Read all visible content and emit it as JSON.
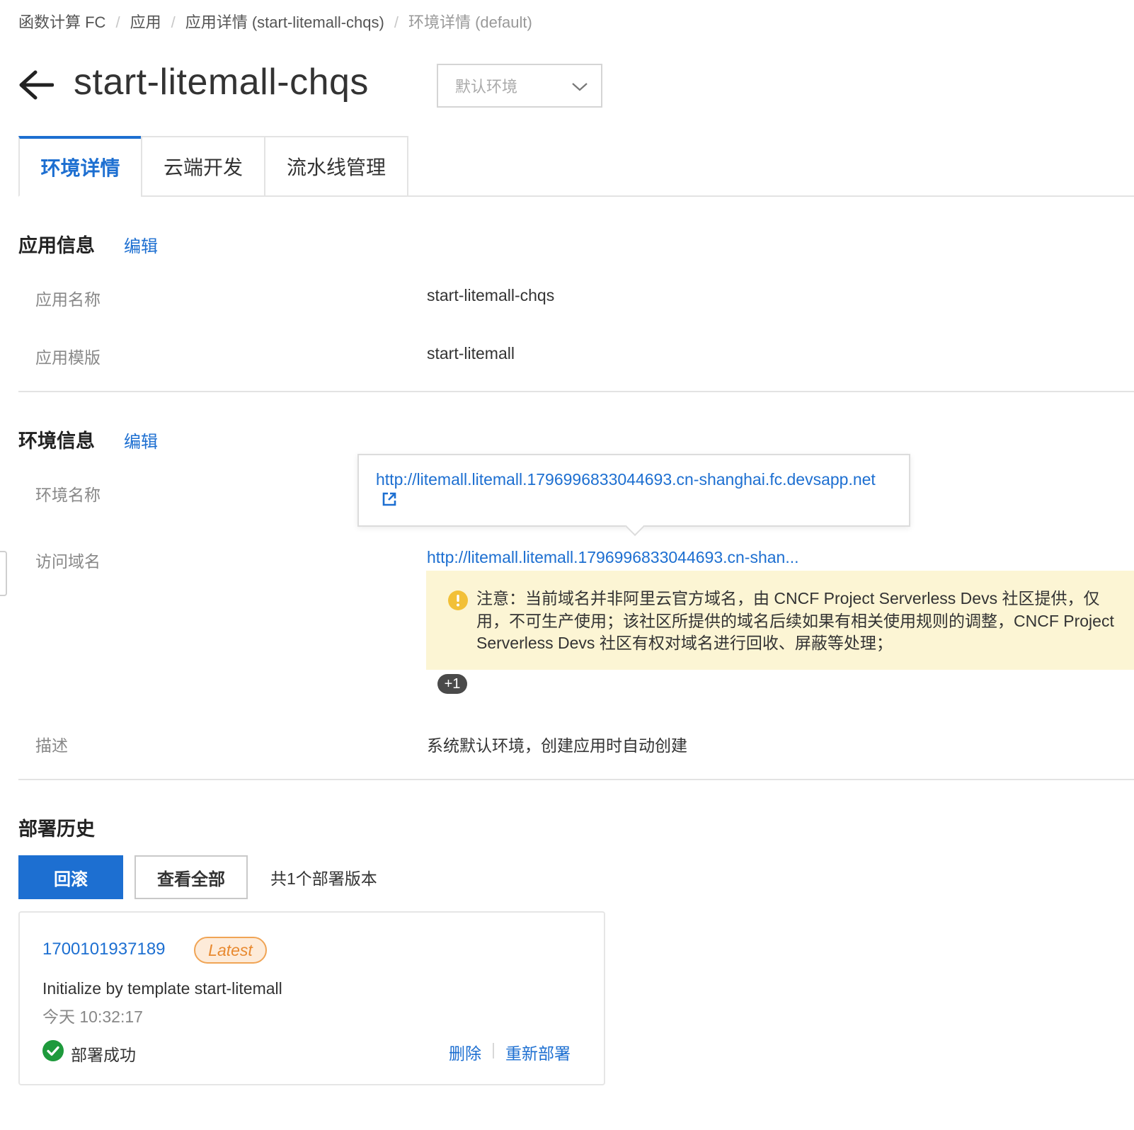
{
  "breadcrumb": {
    "items": [
      "函数计算 FC",
      "应用",
      "应用详情 (start-litemall-chqs)",
      "环境详情 (default)"
    ]
  },
  "header": {
    "title": "start-litemall-chqs",
    "env_select_value": "默认环境",
    "back_icon": "arrow-left-icon",
    "select_icon": "chevron-down-icon"
  },
  "tabs": [
    {
      "label": "环境详情",
      "active": true
    },
    {
      "label": "云端开发",
      "active": false
    },
    {
      "label": "流水线管理",
      "active": false
    }
  ],
  "app_info": {
    "title": "应用信息",
    "edit_label": "编辑",
    "rows": [
      {
        "label": "应用名称",
        "value": "start-litemall-chqs"
      },
      {
        "label": "应用模版",
        "value": "start-litemall"
      }
    ]
  },
  "env_info": {
    "title": "环境信息",
    "edit_label": "编辑",
    "env_name_label": "环境名称",
    "domain_label": "访问域名",
    "domain_truncated": "http://litemall.litemall.1796996833044693.cn-shan...",
    "tooltip_url": "http://litemall.litemall.1796996833044693.cn-shanghai.fc.devsapp.net",
    "tooltip_icon": "external-link-icon",
    "warning_lines": [
      "注意：当前域名并非阿里云官方域名，由 CNCF Project Serverless Devs 社区提供，仅",
      "用，不可生产使用；该社区所提供的域名后续如果有相关使用规则的调整，CNCF Project",
      "Serverless Devs 社区有权对域名进行回收、屏蔽等处理；"
    ],
    "warning_icon": "warning-icon",
    "more_badge": "+1",
    "desc_label": "描述",
    "desc_value": "系统默认环境，创建应用时自动创建"
  },
  "deploy_history": {
    "title": "部署历史",
    "rollback_label": "回滚",
    "view_all_label": "查看全部",
    "total_text": "共1个部署版本",
    "record": {
      "id": "1700101937189",
      "badge": "Latest",
      "description": "Initialize by template start-litemall",
      "time": "今天 10:32:17",
      "status": "部署成功",
      "status_icon": "check-circle-icon",
      "delete_label": "删除",
      "redeploy_label": "重新部署"
    }
  },
  "colors": {
    "primary": "#1d6fd1",
    "warning_bg": "#fcf5d4",
    "warning_icon": "#f2c037",
    "success": "#1e9a3c",
    "latest_border": "#f0a455"
  }
}
